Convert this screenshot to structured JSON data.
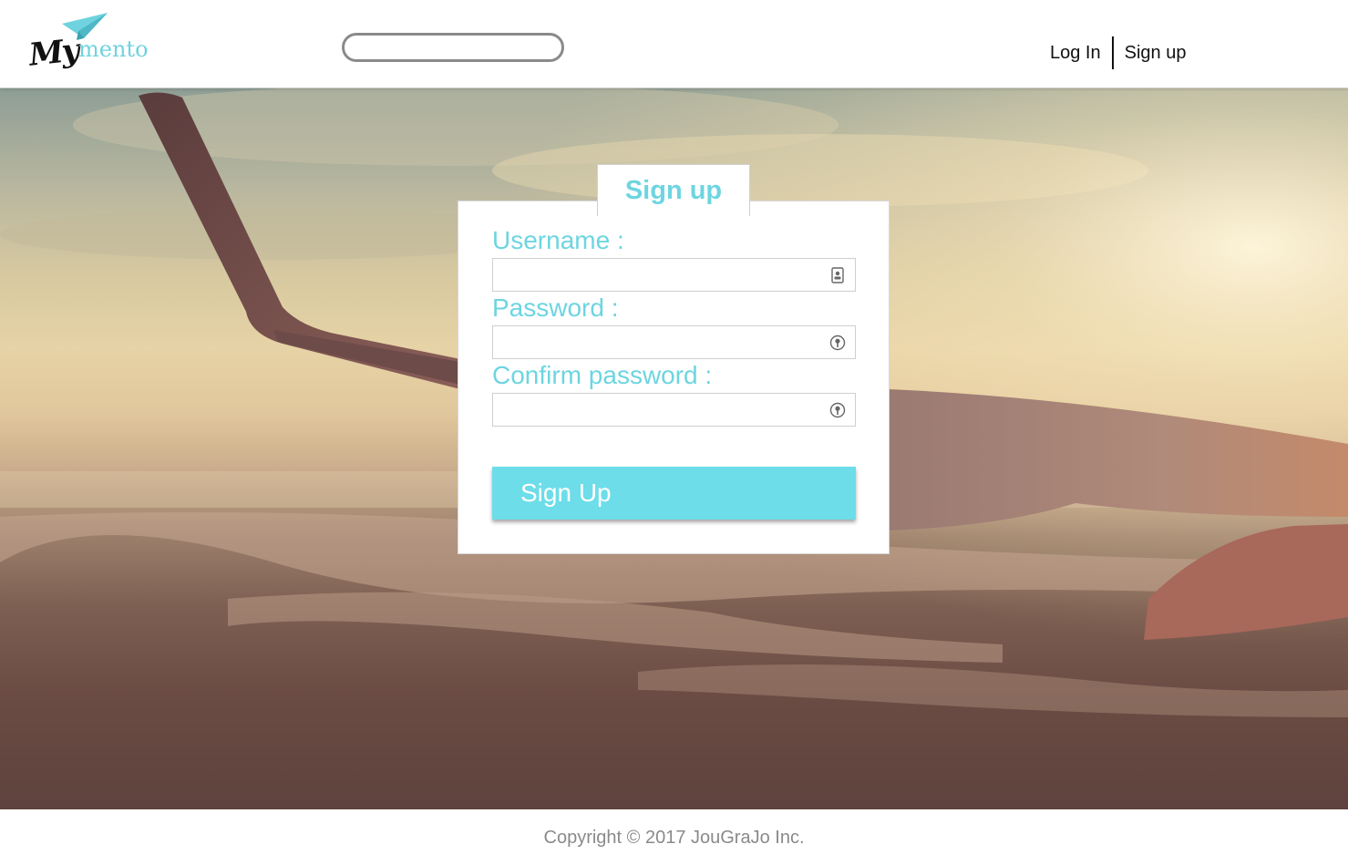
{
  "header": {
    "logo": {
      "word_my": "My",
      "word_mento": "mento",
      "icon": "paper-plane-icon",
      "accent_color": "#6fd3df"
    },
    "search": {
      "value": "",
      "placeholder": ""
    },
    "nav": {
      "login_label": "Log In",
      "signup_label": "Sign up"
    }
  },
  "signup_form": {
    "tab_title": "Sign up",
    "fields": [
      {
        "label": "Username :",
        "value": "",
        "icon": "contact-card-icon"
      },
      {
        "label": "Password :",
        "value": "",
        "icon": "password-key-icon"
      },
      {
        "label": "Confirm password :",
        "value": "",
        "icon": "password-key-icon"
      }
    ],
    "submit_label": "Sign Up",
    "accent_color": "#6dd5e0",
    "button_color": "#6ddde9"
  },
  "hero": {
    "background": "airplane-wing-sunset-photo"
  },
  "footer": {
    "copyright": "Copyright © 2017 JouGraJo Inc."
  }
}
